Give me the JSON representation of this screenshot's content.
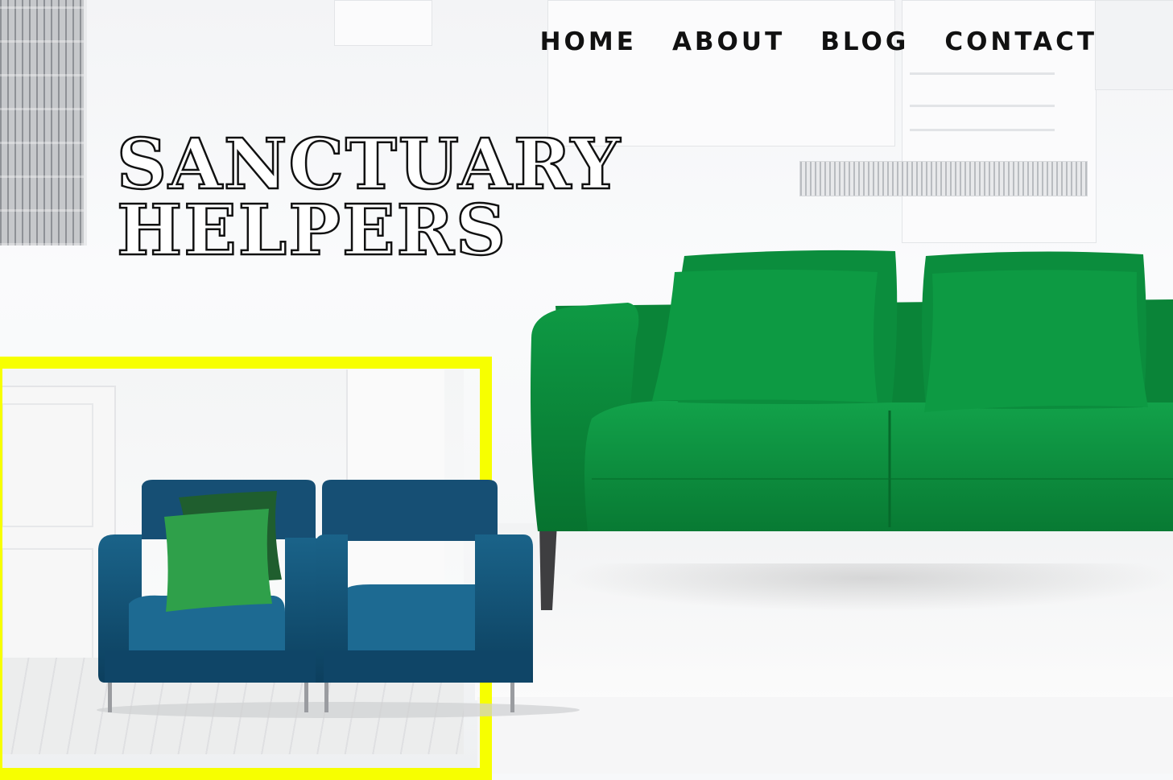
{
  "nav": {
    "items": [
      {
        "label": "HOME"
      },
      {
        "label": "ABOUT"
      },
      {
        "label": "BLOG"
      },
      {
        "label": "CONTACT"
      }
    ]
  },
  "hero": {
    "title_line1": "SANCTUARY",
    "title_line2": "HELPERS"
  },
  "colors": {
    "accent_yellow": "#f7ff00",
    "sofa_green": "#0a8a3a",
    "armchair_blue": "#114f73",
    "text": "#111111"
  }
}
